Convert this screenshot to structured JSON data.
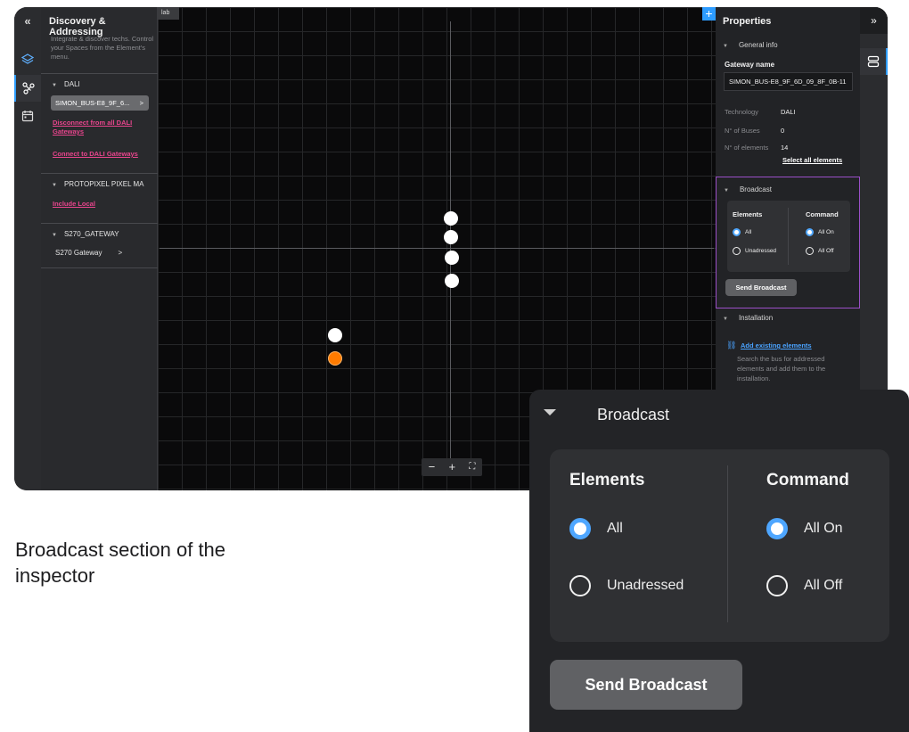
{
  "left_panel": {
    "collapse_icon": "«",
    "title": "Discovery & Addressing",
    "description": "Integrate & discover techs. Control your Spaces from the Element's menu.",
    "dali_group": "DALI",
    "gateway_chip": "SIMON_BUS-E8_9F_6...",
    "gateway_chip_arrow": ">",
    "disconnect_link": "Disconnect from all DALI Gateways",
    "connect_link": "Connect to DALI Gateways",
    "protopixel_group": "PROTOPIXEL PIXEL MA",
    "include_local_link": "Include Local",
    "s270_group": "S270_GATEWAY",
    "s270_item": "S270 Gateway",
    "s270_arrow": ">"
  },
  "canvas": {
    "tab_label": "lab",
    "add_button": "+",
    "zoom_out": "−",
    "zoom_in": "+",
    "fit": "⛶"
  },
  "properties": {
    "title": "Properties",
    "expand_icon": "»",
    "general_info": "General info",
    "gateway_name_label": "Gateway name",
    "gateway_name_value": "SIMON_BUS-E8_9F_6D_09_8F_0B-11",
    "technology_label": "Technology",
    "technology_value": "DALI",
    "buses_label": "N° of Buses",
    "buses_value": "0",
    "elements_label": "N° of elements",
    "elements_value": "14",
    "select_all": "Select all elements",
    "broadcast": "Broadcast",
    "elements_heading": "Elements",
    "command_heading": "Command",
    "opt_all": "All",
    "opt_unadressed": "Unadressed",
    "opt_all_on": "All On",
    "opt_all_off": "All Off",
    "send_broadcast": "Send Broadcast",
    "installation": "Installation",
    "add_existing": "Add existing elements",
    "add_existing_desc": "Search the bus for addressed elements and add them to the installation."
  },
  "zoom_card": {
    "title": "Broadcast",
    "elements_heading": "Elements",
    "command_heading": "Command",
    "opt_all": "All",
    "opt_unadressed": "Unadressed",
    "opt_all_on": "All On",
    "opt_all_off": "All Off",
    "send_broadcast": "Send Broadcast"
  },
  "caption": "Broadcast section of the inspector",
  "colors": {
    "accent_blue": "#2d9cff",
    "link_pink": "#e8458d",
    "highlight_purple": "#9b4fc8",
    "node_orange": "#ff7b00"
  }
}
